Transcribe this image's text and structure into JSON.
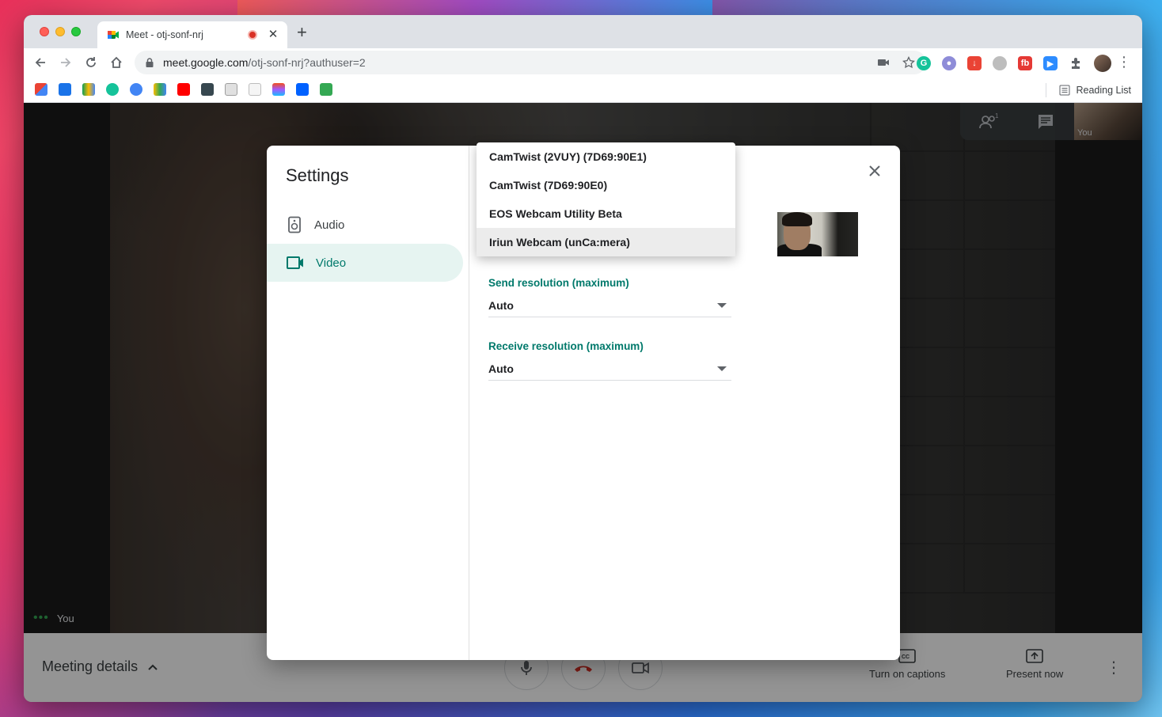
{
  "browser": {
    "tab_title": "Meet - otj-sonf-nrj",
    "url_host": "meet.google.com",
    "url_path": "/otj-sonf-nrj?authuser=2",
    "reading_list": "Reading List"
  },
  "meet": {
    "self_label": "You",
    "thumbnail_label": "You",
    "meeting_details": "Meeting details",
    "captions_label": "Turn on captions",
    "present_label": "Present now"
  },
  "settings": {
    "title": "Settings",
    "nav": [
      {
        "label": "Audio",
        "icon": "speaker-icon"
      },
      {
        "label": "Video",
        "icon": "videocam-icon",
        "active": true
      }
    ],
    "camera_options": [
      "CamTwist (2VUY) (7D69:90E1)",
      "CamTwist (7D69:90E0)",
      "EOS Webcam Utility Beta",
      "Iriun Webcam (unCa:mera)"
    ],
    "camera_selected_index": 3,
    "send_resolution": {
      "label": "Send resolution (maximum)",
      "value": "Auto"
    },
    "receive_resolution": {
      "label": "Receive resolution (maximum)",
      "value": "Auto"
    }
  },
  "colors": {
    "accent": "#00796b",
    "active_nav_bg": "#e6f4f1",
    "recording": "#d93025"
  }
}
